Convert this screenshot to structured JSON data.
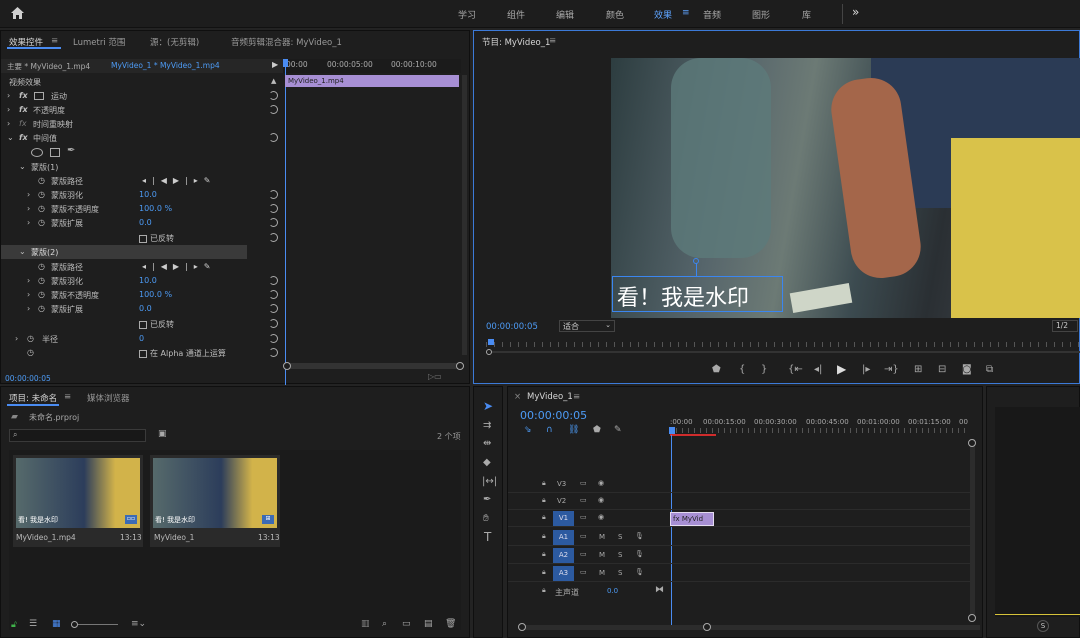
{
  "workspaces": [
    "学习",
    "组件",
    "编辑",
    "颜色",
    "效果",
    "音频",
    "图形",
    "库"
  ],
  "active_workspace": "效果",
  "more_icon": "»",
  "effects_panel": {
    "tabs": [
      "效果控件",
      "Lumetri 范围",
      "源：(无剪辑)",
      "音频剪辑混合器: MyVideo_1"
    ],
    "master_label": "主要 * MyVideo_1.mp4",
    "seq_label": "MyVideo_1 * MyVideo_1.mp4",
    "ruler": [
      "00:00",
      "00:00:05:00",
      "00:00:10:00"
    ],
    "clip_name": "MyVideo_1.mp4",
    "section": "视频效果",
    "rows": [
      {
        "name": "运动"
      },
      {
        "name": "不透明度"
      },
      {
        "name": "时间重映射"
      },
      {
        "name": "中间值"
      }
    ],
    "mask1": "蒙版(1)",
    "mask2": "蒙版(2)",
    "mask_path": "蒙版路径",
    "feather": "蒙版羽化",
    "feather_val": "10.0",
    "opacity": "蒙版不透明度",
    "opacity_val": "100.0 %",
    "expand": "蒙版扩展",
    "expand_val": "0.0",
    "inverted": "已反转",
    "radius": "半径",
    "radius_val": "0",
    "alpha": "在 Alpha 通道上运算",
    "timecode": "00:00:00:05"
  },
  "program": {
    "title": "节目: MyVideo_1",
    "watermark": "看！我是水印",
    "timecode": "00:00:00:05",
    "fit": "适合",
    "page": "1/2"
  },
  "project": {
    "tabs": [
      "项目: 未命名",
      "媒体浏览器"
    ],
    "file": "未命名.prproj",
    "count": "2 个项",
    "items": [
      {
        "name": "MyVideo_1.mp4",
        "dur": "13:13",
        "wm": "看! 我是水印"
      },
      {
        "name": "MyVideo_1",
        "dur": "13:13",
        "wm": "看! 我是水印"
      }
    ]
  },
  "timeline": {
    "title": "MyVideo_1",
    "timecode": "00:00:00:05",
    "ruler": [
      ":00:00",
      "00:00:15:00",
      "00:00:30:00",
      "00:00:45:00",
      "00:01:00:00",
      "00:01:15:00",
      "00"
    ],
    "tracks": [
      "V3",
      "V2",
      "V1",
      "A1",
      "A2",
      "A3"
    ],
    "master": "主声道",
    "master_val": "0.0",
    "clip_label": "fx MyVid",
    "m": "M",
    "s": "S"
  },
  "meter_s": "S"
}
